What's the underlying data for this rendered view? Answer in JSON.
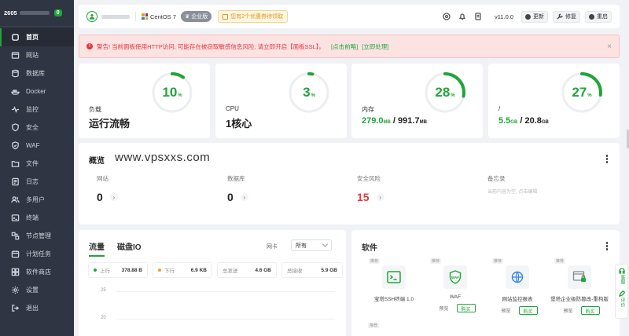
{
  "sidebar": {
    "server_name": "2605",
    "badge": "0",
    "items": [
      {
        "label": "首页",
        "icon": "home-icon",
        "active": true
      },
      {
        "label": "网站",
        "icon": "website-icon"
      },
      {
        "label": "数据库",
        "icon": "database-icon"
      },
      {
        "label": "Docker",
        "icon": "docker-icon"
      },
      {
        "label": "监控",
        "icon": "monitor-icon"
      },
      {
        "label": "安全",
        "icon": "shield-icon"
      },
      {
        "label": "WAF",
        "icon": "waf-icon"
      },
      {
        "label": "文件",
        "icon": "folder-icon"
      },
      {
        "label": "日志",
        "icon": "log-icon"
      },
      {
        "label": "多用户",
        "icon": "users-icon"
      },
      {
        "label": "终端",
        "icon": "terminal-icon"
      },
      {
        "label": "节点管理",
        "icon": "node-icon"
      },
      {
        "label": "计划任务",
        "icon": "calendar-icon"
      },
      {
        "label": "软件商店",
        "icon": "store-icon"
      },
      {
        "label": "设置",
        "icon": "gear-icon"
      },
      {
        "label": "退出",
        "icon": "logout-icon"
      }
    ]
  },
  "topbar": {
    "os": "CentOS 7",
    "edition": "企业版",
    "promo": "您有2个优惠券待领取",
    "version": "v11.0.0",
    "update_label": "更新",
    "repair_label": "修复",
    "restart_label": "重启"
  },
  "alert": {
    "text": "警告! 当前面板使用HTTP访问, 可能存在被窃取敏感信息风险, 请立即开启【面板SSL】。",
    "link1": "[点击前略]",
    "link2": "[立即处理]",
    "close": "×"
  },
  "stats": [
    {
      "label": "负载",
      "value": "运行流畅",
      "percent": 10,
      "pct_text": "10"
    },
    {
      "label": "CPU",
      "value": "1核心",
      "percent": 3,
      "pct_text": "3"
    },
    {
      "label": "内存",
      "used": "279.0",
      "used_unit": "MB",
      "total": "991.7",
      "total_unit": "MB",
      "percent": 28,
      "pct_text": "28"
    },
    {
      "label": "/",
      "used": "5.5",
      "used_unit": "GB",
      "total": "20.8",
      "total_unit": "GB",
      "percent": 27,
      "pct_text": "27"
    }
  ],
  "overview": {
    "title": "概览",
    "site": "www.vpsxxs.com",
    "cols": [
      {
        "label": "网站",
        "value": "0"
      },
      {
        "label": "数据库",
        "value": "0"
      },
      {
        "label": "安全风险",
        "value": "15"
      },
      {
        "label": "备忘录",
        "hint": "当前内容为空, 点击编辑"
      }
    ]
  },
  "traffic": {
    "tabs": [
      "流量",
      "磁盘IO"
    ],
    "nic_label": "网卡",
    "nic_value": "所有",
    "stats": [
      {
        "label": "上行",
        "value": "378.88 B",
        "color": "#20a53a"
      },
      {
        "label": "下行",
        "value": "6.9 KB",
        "color": "#f0a020"
      },
      {
        "label": "总发送",
        "value": "4.6 GB"
      },
      {
        "label": "总接收",
        "value": "5.9 GB"
      }
    ],
    "y_ticks": [
      "25",
      "20"
    ]
  },
  "software": {
    "title": "软件",
    "items": [
      {
        "tag": "推荐",
        "name": "宝塔SSH终端 1.0",
        "icon": "terminal-app-icon",
        "preview": "",
        "buy": ""
      },
      {
        "tag": "推荐",
        "name": "WAF",
        "icon": "waf-app-icon",
        "preview": "预览",
        "buy": "购买"
      },
      {
        "tag": "推荐",
        "name": "网站监控报表",
        "icon": "globe-app-icon",
        "preview": "预览",
        "buy": "购买"
      },
      {
        "tag": "推荐",
        "name": "堡塔企业级防篡改-重构版",
        "icon": "tamper-app-icon",
        "preview": "预览",
        "buy": "购买"
      }
    ],
    "extra_tag": "推荐"
  },
  "float": {
    "service": "客服",
    "feedback": "评价"
  },
  "colors": {
    "accent": "#20a53a",
    "danger": "#e0393e",
    "sidebar": "#2f3542"
  }
}
